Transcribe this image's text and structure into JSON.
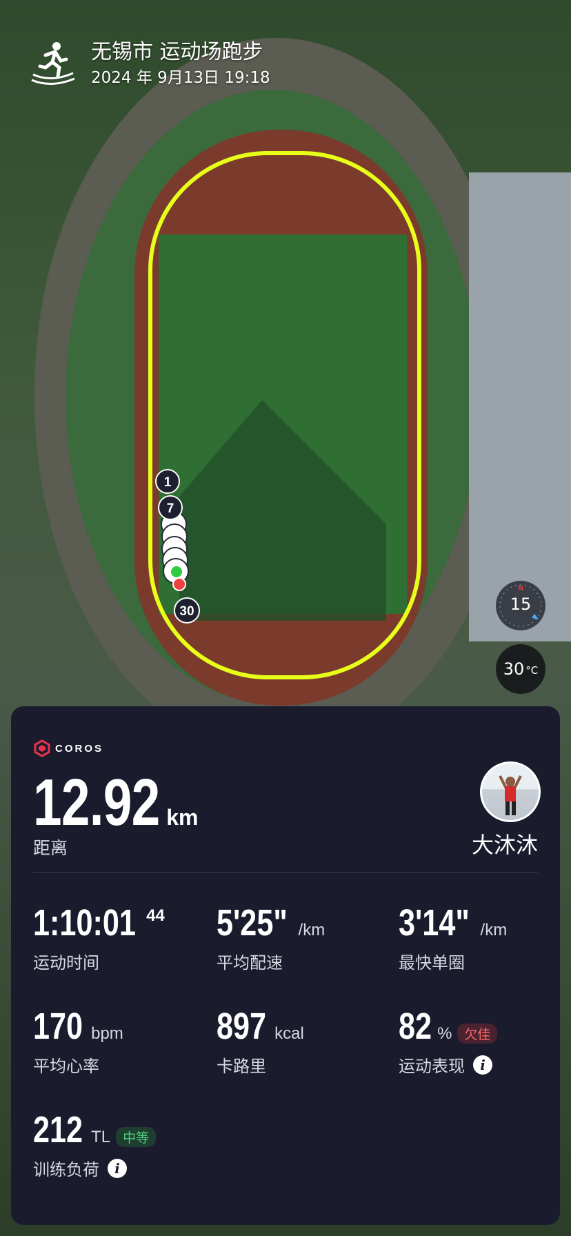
{
  "header": {
    "place_title": "无锡市 运动场跑步",
    "date_time": "2024 年 9月13日 19:18",
    "icon": "running-track-icon"
  },
  "map": {
    "route_color": "#e8ff1a",
    "lap_markers": [
      "1",
      "7",
      "30"
    ],
    "compass_value": "15",
    "temperature": "30",
    "temperature_unit": "°C"
  },
  "card": {
    "brand": "COROS",
    "brand_color": "#e8334a",
    "distance": {
      "value": "12.92",
      "unit": "km",
      "label": "距离"
    },
    "user": {
      "name": "大沐沐",
      "avatar": "avatar-runner"
    },
    "stats": {
      "duration": {
        "value": "1:10:01",
        "sub": "44",
        "label": "运动时间"
      },
      "avg_pace": {
        "value": "5'25\"",
        "unit": "/km",
        "label": "平均配速"
      },
      "fastest_lap": {
        "value": "3'14\"",
        "unit": "/km",
        "label": "最快单圈"
      },
      "avg_hr": {
        "value": "170",
        "unit": "bpm",
        "label": "平均心率"
      },
      "calories": {
        "value": "897",
        "unit": "kcal",
        "label": "卡路里"
      },
      "performance": {
        "value": "82",
        "unit": "%",
        "badge": "欠佳",
        "label": "运动表现"
      },
      "training_load": {
        "value": "212",
        "unit": "TL",
        "badge": "中等",
        "label": "训练负荷"
      }
    },
    "info_icon": "i"
  }
}
